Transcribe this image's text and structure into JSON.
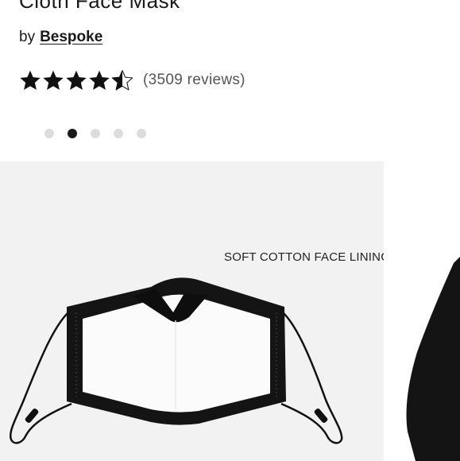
{
  "product": {
    "title": "Cloth Face Mask",
    "by_label": "by",
    "brand": "Bespoke",
    "rating": 4.5,
    "max_rating": 5,
    "reviews_text": "(3509 reviews)"
  },
  "carousel": {
    "slide_count": 5,
    "active_index": 1,
    "current_slide": {
      "caption": "SOFT COTTON FACE LINING"
    }
  },
  "colors": {
    "text": "#1a1a1a",
    "muted": "#555555",
    "image_bg": "#f2f2f2",
    "dot_inactive": "#dcdcdc",
    "dot_active": "#1a1a1a"
  }
}
